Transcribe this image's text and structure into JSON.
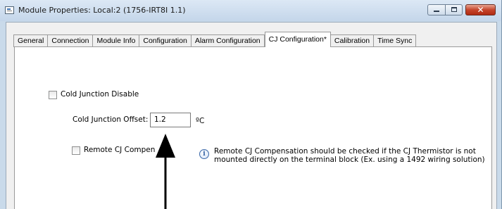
{
  "window": {
    "title": "Module Properties: Local:2 (1756-IRT8I 1.1)",
    "controls": {
      "minimize_icon": "minimize-icon",
      "maximize_icon": "maximize-icon",
      "close_glyph": "✕"
    }
  },
  "tabs": [
    {
      "label": "General",
      "active": false
    },
    {
      "label": "Connection",
      "active": false
    },
    {
      "label": "Module Info",
      "active": false
    },
    {
      "label": "Configuration",
      "active": false
    },
    {
      "label": "Alarm Configuration",
      "active": false
    },
    {
      "label": "CJ Configuration*",
      "active": true
    },
    {
      "label": "Calibration",
      "active": false
    },
    {
      "label": "Time Sync",
      "active": false
    }
  ],
  "cj_config": {
    "cold_junction_disable": {
      "label": "Cold Junction Disable",
      "checked": false
    },
    "offset": {
      "label": "Cold Junction Offset:",
      "value": "1.2",
      "unit": "ºC"
    },
    "remote_cj": {
      "label": "Remote CJ Compensation",
      "checked": false
    },
    "note_line1": "Remote CJ Compensation should be checked if the CJ Thermistor is not",
    "note_line2": "mounted directly on the terminal block (Ex. using a 1492 wiring solution)"
  },
  "colors": {
    "title_bar": "#c9daea",
    "panel": "#ffffff",
    "dialog": "#f0f0f0",
    "close_button": "#c6452c"
  }
}
